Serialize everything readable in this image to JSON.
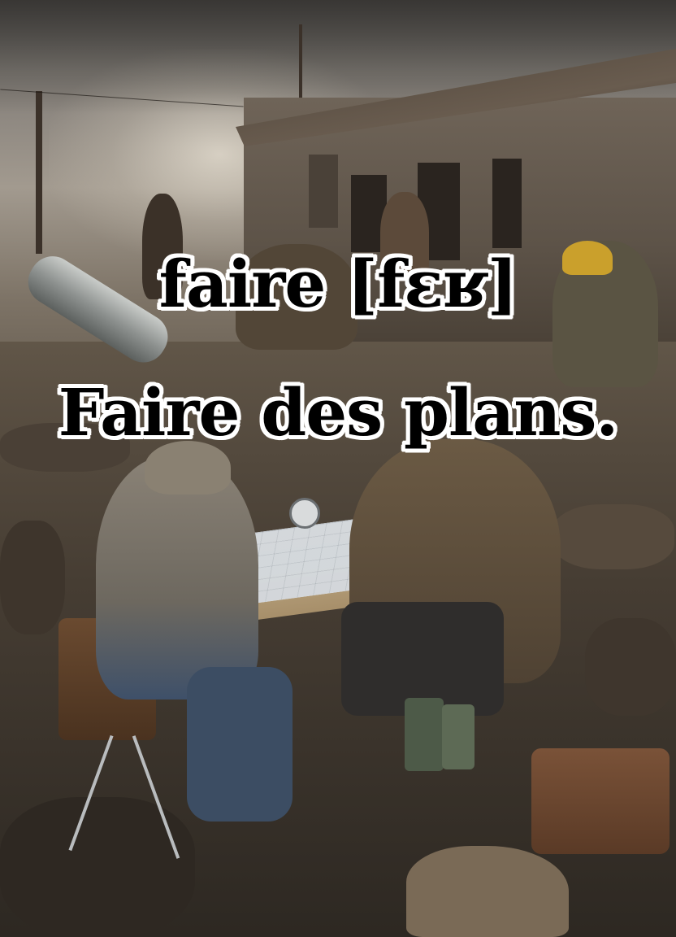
{
  "overlay": {
    "line1": "faire [fɛʁ]",
    "line2": "Faire des plans."
  }
}
